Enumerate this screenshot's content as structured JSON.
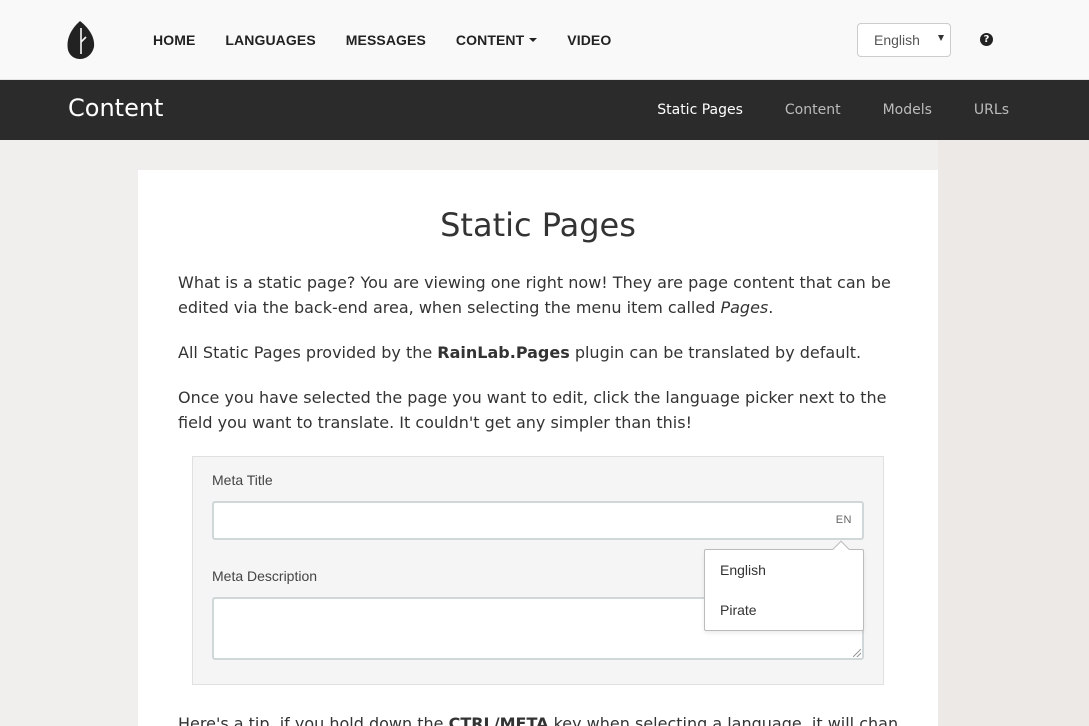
{
  "nav": {
    "links": [
      {
        "label": "HOME"
      },
      {
        "label": "LANGUAGES"
      },
      {
        "label": "MESSAGES"
      },
      {
        "label": "CONTENT"
      },
      {
        "label": "VIDEO"
      }
    ],
    "language_select": "English",
    "help_icon": "question-circle-icon"
  },
  "subheader": {
    "title": "Content",
    "links": [
      {
        "label": "Static Pages"
      },
      {
        "label": "Content"
      },
      {
        "label": "Models"
      },
      {
        "label": "URLs"
      }
    ]
  },
  "main": {
    "title": "Static Pages",
    "para1_a": "What is a static page? You are viewing one right now! They are page content that can be edited via the back-end area, when selecting the menu item called ",
    "para1_em": "Pages",
    "para1_b": ".",
    "para2_a": "All Static Pages provided by the ",
    "para2_strong": "RainLab.Pages",
    "para2_b": " plugin can be translated by default.",
    "para3": "Once you have selected the page you want to edit, click the language picker next to the field you want to translate. It couldn't get any simpler than this!",
    "form": {
      "meta_title_label": "Meta Title",
      "meta_title_locale": "EN",
      "meta_description_label": "Meta Description",
      "dropdown_options": [
        "English",
        "Pirate"
      ]
    },
    "tip_a": "Here's a tip, if you hold down the ",
    "tip_strong": "CTRL/META",
    "tip_b": " key when selecting a language, it will change the"
  },
  "colors": {
    "topnav_bg": "#f9f9f9",
    "subheader_bg": "#2b2b2b",
    "page_bg": "#f1efed",
    "card_bg": "#ffffff"
  }
}
